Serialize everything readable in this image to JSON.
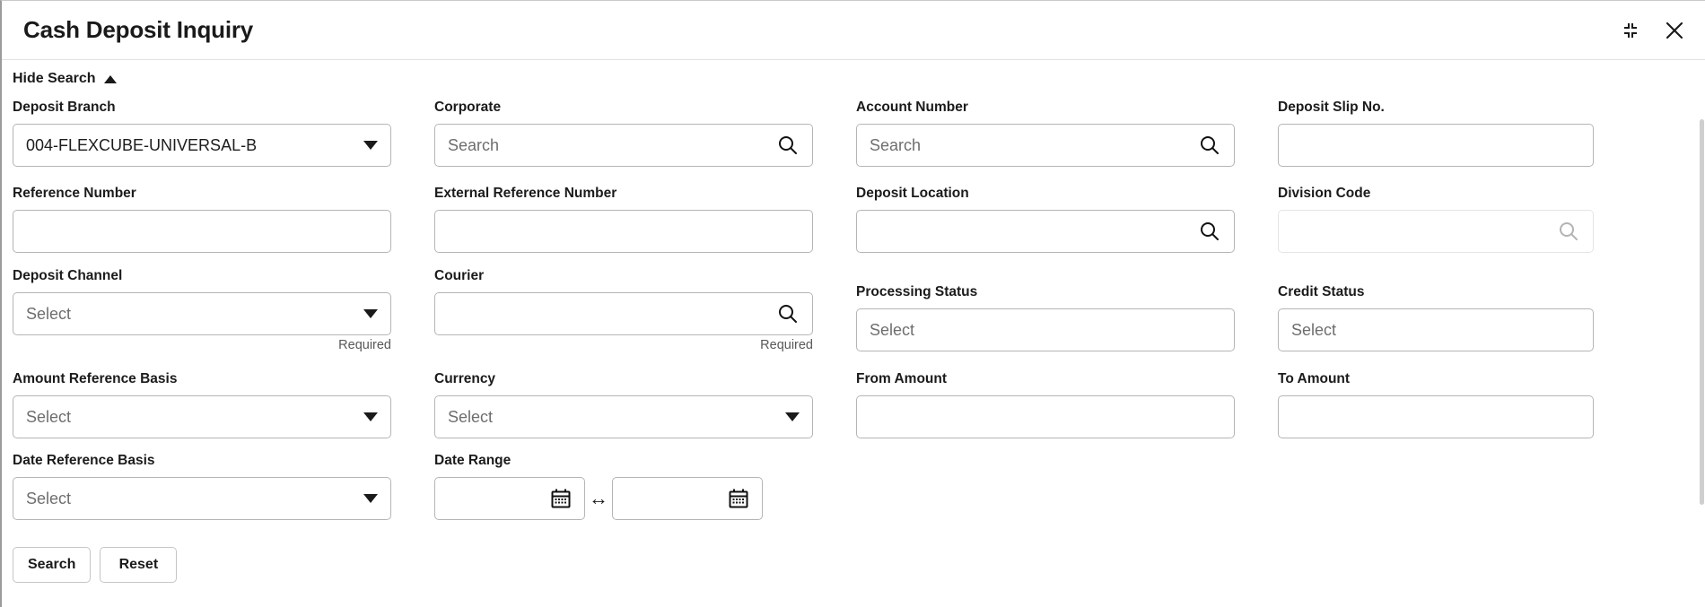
{
  "window": {
    "title": "Cash Deposit Inquiry",
    "minimize_icon": "collapse-corners-icon",
    "close_icon": "close-icon"
  },
  "search_panel": {
    "toggle_label": "Hide Search",
    "toggle_icon": "chevron-up-icon"
  },
  "fields": {
    "deposit_branch": {
      "label": "Deposit Branch",
      "value": "004-FLEXCUBE-UNIVERSAL-B",
      "type": "select"
    },
    "corporate": {
      "label": "Corporate",
      "placeholder": "Search",
      "type": "lov",
      "icon": "search-icon"
    },
    "account_number": {
      "label": "Account Number",
      "placeholder": "Search",
      "type": "lov",
      "icon": "search-icon"
    },
    "deposit_slip_no": {
      "label": "Deposit Slip No.",
      "value": "",
      "type": "text"
    },
    "reference_number": {
      "label": "Reference Number",
      "value": "",
      "type": "text"
    },
    "external_reference_number": {
      "label": "External Reference Number",
      "value": "",
      "type": "text"
    },
    "deposit_location": {
      "label": "Deposit Location",
      "value": "",
      "type": "lov",
      "icon": "search-icon"
    },
    "division_code": {
      "label": "Division Code",
      "value": "",
      "type": "lov",
      "icon": "search-icon",
      "disabled": true
    },
    "deposit_channel": {
      "label": "Deposit Channel",
      "placeholder": "Select",
      "type": "select",
      "hint": "Required"
    },
    "courier": {
      "label": "Courier",
      "value": "",
      "type": "lov",
      "icon": "search-icon",
      "hint": "Required"
    },
    "processing_status": {
      "label": "Processing Status",
      "placeholder": "Select",
      "type": "multiselect"
    },
    "credit_status": {
      "label": "Credit Status",
      "placeholder": "Select",
      "type": "multiselect"
    },
    "amount_reference_basis": {
      "label": "Amount Reference Basis",
      "placeholder": "Select",
      "type": "select"
    },
    "currency": {
      "label": "Currency",
      "placeholder": "Select",
      "type": "select"
    },
    "from_amount": {
      "label": "From Amount",
      "value": "",
      "type": "text"
    },
    "to_amount": {
      "label": "To Amount",
      "value": "",
      "type": "text"
    },
    "date_reference_basis": {
      "label": "Date Reference Basis",
      "placeholder": "Select",
      "type": "select"
    },
    "date_range": {
      "label": "Date Range",
      "from_value": "",
      "to_value": "",
      "separator": "↔",
      "icon": "calendar-icon"
    }
  },
  "actions": {
    "search_label": "Search",
    "reset_label": "Reset"
  }
}
